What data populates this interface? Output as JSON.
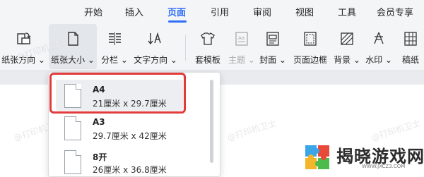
{
  "tabs": [
    {
      "label": "开始",
      "active": false
    },
    {
      "label": "插入",
      "active": false
    },
    {
      "label": "页面",
      "active": true
    },
    {
      "label": "引用",
      "active": false
    },
    {
      "label": "审阅",
      "active": false
    },
    {
      "label": "视图",
      "active": false
    },
    {
      "label": "工具",
      "active": false
    },
    {
      "label": "会员专享",
      "active": false
    }
  ],
  "ribbon": {
    "orientation": {
      "label": "纸张方向 ⌄",
      "icon": "page-orientation-icon"
    },
    "size": {
      "label": "纸张大小 ⌄",
      "icon": "page-size-icon"
    },
    "columns": {
      "label": "分栏 ⌄",
      "icon": "columns-icon"
    },
    "direction": {
      "label": "文字方向 ⌄",
      "icon": "text-direction-icon"
    },
    "template": {
      "label": "套模板",
      "icon": "template-icon"
    },
    "theme": {
      "label": "主题 ⌄",
      "icon": "theme-icon"
    },
    "cover": {
      "label": "封面 ⌄",
      "icon": "cover-icon"
    },
    "border": {
      "label": "页面边框",
      "icon": "page-border-icon"
    },
    "background": {
      "label": "背景 ⌄",
      "icon": "background-icon"
    },
    "watermark": {
      "label": "水印 ⌄",
      "icon": "watermark-icon"
    },
    "paper": {
      "label": "稿纸",
      "icon": "manuscript-paper-icon"
    }
  },
  "paper_sizes": [
    {
      "name": "A4",
      "dims": "21厘米  x  29.7厘米",
      "selected": true
    },
    {
      "name": "A3",
      "dims": "29.7厘米  x  42厘米",
      "selected": false
    },
    {
      "name": "8开",
      "dims": "26厘米  x  36.8厘米",
      "selected": false
    }
  ],
  "watermark_text": "@打印机卫士",
  "logo": {
    "text": "揭晓游戏网",
    "url": "WWW.JXCZ3.COM"
  },
  "colors": {
    "accent": "#2f6ff5",
    "highlight_box": "#e23b3b"
  }
}
